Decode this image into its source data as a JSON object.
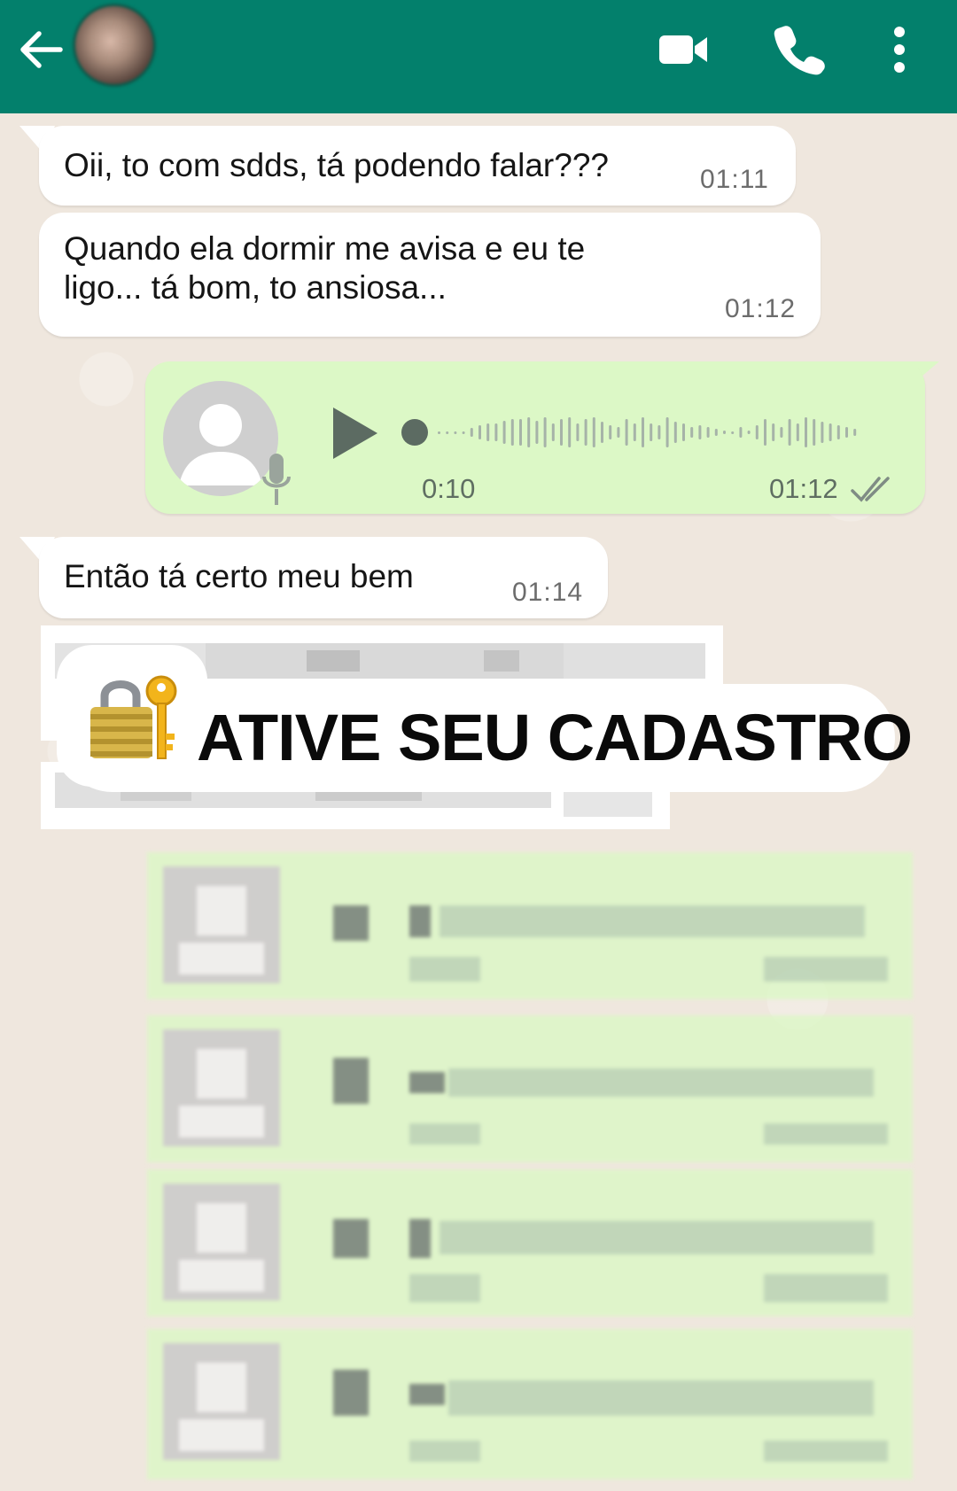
{
  "header": {
    "back_icon": "arrow-left-icon",
    "video_icon": "video-camera-icon",
    "call_icon": "phone-icon",
    "menu_icon": "more-vertical-icon",
    "bar_color": "#03806c"
  },
  "messages": [
    {
      "direction": "in",
      "text": "Oii, to com sdds, tá podendo falar???",
      "time": "01:11"
    },
    {
      "direction": "in",
      "text_line1": "Quando ela dormir me avisa e eu te",
      "text_line2": "ligo... tá bom, to ansiosa...",
      "time": "01:12"
    },
    {
      "direction": "out",
      "type": "voice",
      "duration": "0:10",
      "time": "01:12",
      "status_icon": "double-check-icon"
    },
    {
      "direction": "in",
      "text": "Então tá certo meu bem",
      "time": "01:14"
    }
  ],
  "promo": {
    "icon": "lock-with-key-icon",
    "text": "ATIVE SEU CADASTRO"
  },
  "colors": {
    "incoming_bubble": "#ffffff",
    "outgoing_bubble": "#dcf8c6",
    "chat_background": "#efe7de"
  }
}
